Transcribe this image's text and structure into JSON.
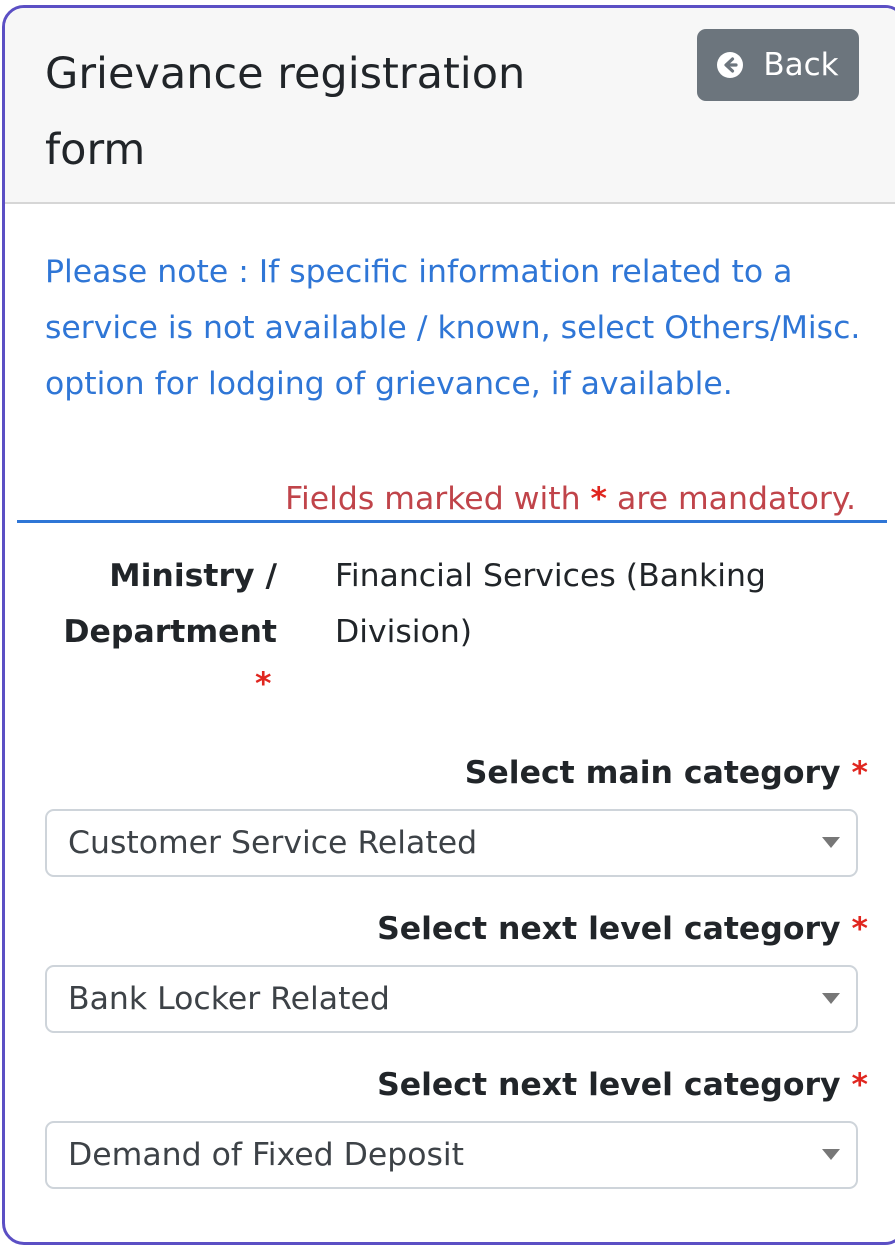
{
  "header": {
    "title": "Grievance registration form",
    "back_label": "Back"
  },
  "note": {
    "text": "Please note : If specific information related to a service is not available / known, select Others/Misc. option for lodging of grievance, if available.",
    "mandatory_prefix": "Fields marked with ",
    "mandatory_star": "*",
    "mandatory_suffix": " are mandatory."
  },
  "ministry": {
    "label": "Ministry / Department",
    "required_marker": "*",
    "value": "Financial Services (Banking Division)"
  },
  "fields": [
    {
      "label": "Select main category",
      "required_marker": "*",
      "selected": "Customer Service Related"
    },
    {
      "label": "Select next level category",
      "required_marker": "*",
      "selected": "Bank Locker Related"
    },
    {
      "label": "Select next level category",
      "required_marker": "*",
      "selected": "Demand of Fixed Deposit"
    }
  ],
  "icons": {
    "back": "arrow-circle-left-icon",
    "dropdown": "caret-down-icon"
  },
  "colors": {
    "frame_border": "#5b4fc4",
    "note_text": "#2f76d6",
    "mandatory_text": "#c0444a",
    "required_star": "#e0261f",
    "back_button": "#6c757d"
  }
}
